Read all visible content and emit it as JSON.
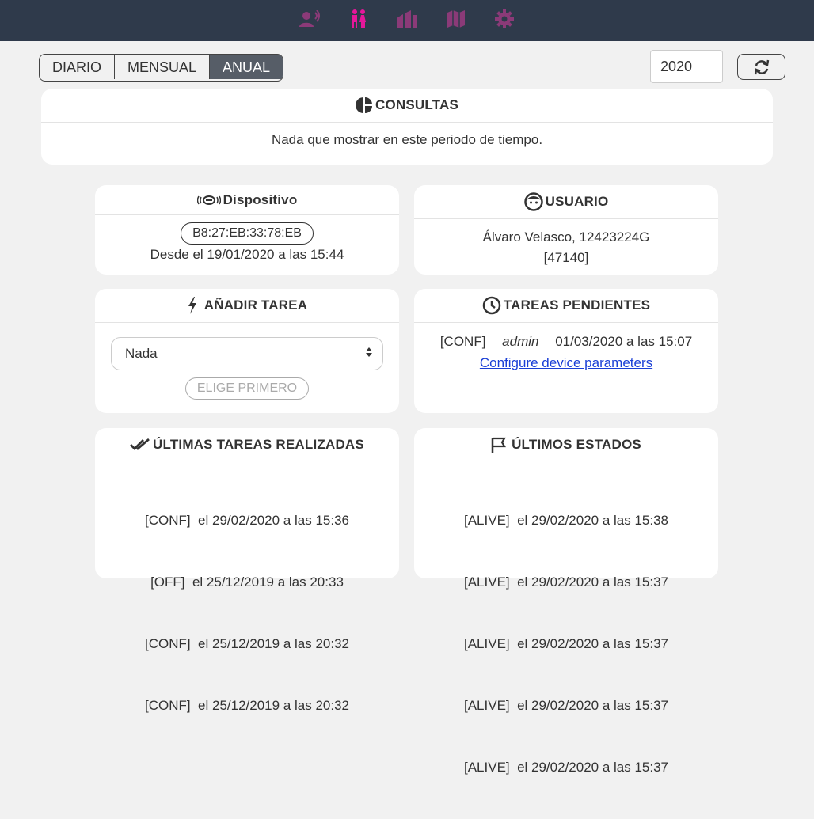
{
  "nav": {
    "colors": {
      "dim": "#8b3a78",
      "active": "#e6179a"
    },
    "icons": [
      "user-voice-icon",
      "restroom-icon",
      "building-icon",
      "map-icon",
      "gear-icon"
    ]
  },
  "tabs": [
    "DIARIO",
    "MENSUAL",
    "ANUAL"
  ],
  "year": "2020",
  "consultas": {
    "title": "CONSULTAS",
    "message": "Nada que mostrar en este periodo de tiempo."
  },
  "dispositivo": {
    "title": "Dispositivo",
    "mac": "B8:27:EB:33:78:EB",
    "since": "Desde el 19/01/2020 a las 15:44"
  },
  "usuario": {
    "title": "USUARIO",
    "name": "Álvaro Velasco, 12423224G",
    "code": "[47140]"
  },
  "anadir": {
    "title": "AÑADIR TAREA",
    "select_value": "Nada",
    "button": "ELIGE PRIMERO"
  },
  "pendientes": {
    "title": "TAREAS PENDIENTES",
    "task_type": "[CONF]",
    "task_user": "admin",
    "task_date": "01/03/2020 a las 15:07",
    "task_link": "Configure device parameters"
  },
  "realizadas": {
    "title": "ÚLTIMAS TAREAS REALIZADAS",
    "rows": [
      "[CONF]  el 29/02/2020 a las 15:36",
      "[OFF]  el 25/12/2019 a las 20:33",
      "[CONF]  el 25/12/2019 a las 20:32",
      "[CONF]  el 25/12/2019 a las 20:32"
    ]
  },
  "estados": {
    "title": "ÚLTIMOS ESTADOS",
    "rows": [
      "[ALIVE]  el 29/02/2020 a las 15:38",
      "[ALIVE]  el 29/02/2020 a las 15:37",
      "[ALIVE]  el 29/02/2020 a las 15:37",
      "[ALIVE]  el 29/02/2020 a las 15:37",
      "[ALIVE]  el 29/02/2020 a las 15:37"
    ]
  }
}
